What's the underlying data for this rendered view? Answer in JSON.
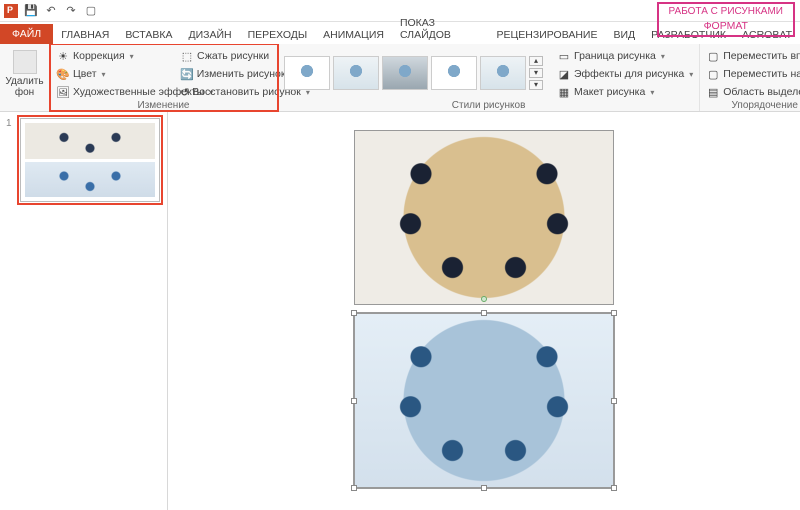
{
  "titlebar": {
    "app": "PowerPoint"
  },
  "tabs": {
    "file": "ФАЙЛ",
    "items": [
      "ГЛАВНАЯ",
      "ВСТАВКА",
      "ДИЗАЙН",
      "ПЕРЕХОДЫ",
      "АНИМАЦИЯ",
      "ПОКАЗ СЛАЙДОВ",
      "РЕЦЕНЗИРОВАНИЕ",
      "ВИД",
      "РАЗРАБОТЧИК",
      "ACROBAT"
    ],
    "context": {
      "title": "РАБОТА С РИСУНКАМИ",
      "tab": "ФОРМАТ"
    }
  },
  "ribbon": {
    "removeBg": "Удалить\nфон",
    "adjust": {
      "corrections": "Коррекция",
      "color": "Цвет",
      "artistic": "Художественные эффекты",
      "compress": "Сжать рисунки",
      "change": "Изменить рисунок",
      "reset": "Восстановить рисунок",
      "label": "Изменение"
    },
    "styles": {
      "label": "Стили рисунков"
    },
    "border": {
      "border": "Граница рисунка",
      "effects": "Эффекты для рисунка",
      "layout": "Макет рисунка"
    },
    "arrange": {
      "forward": "Переместить вперед",
      "backward": "Переместить назад",
      "selection": "Область выделения",
      "label": "Упорядочение"
    }
  },
  "thumbs": {
    "num1": "1"
  }
}
